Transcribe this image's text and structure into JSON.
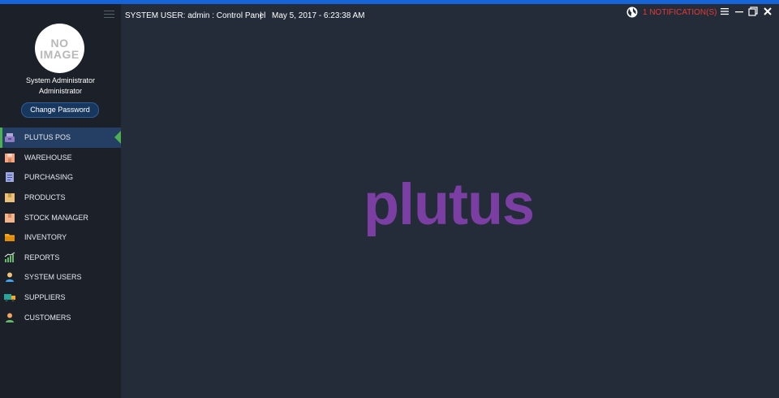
{
  "colors": {
    "top_accent": "#1565d8",
    "sidebar_bg": "#1c2129",
    "main_bg": "#252c39",
    "active_item_bg": "#253e63",
    "active_indicator": "#4caf50",
    "notification_text": "#e53935",
    "logo_color": "#7b3fa3"
  },
  "sidebar": {
    "avatar_line1": "NO",
    "avatar_line2": "IMAGE",
    "user_name": "System Administrator",
    "user_role": "Administrator",
    "change_password_label": "Change Password",
    "items": [
      {
        "label": "PLUTUS POS",
        "icon": "pos-register-icon",
        "active": true
      },
      {
        "label": "WAREHOUSE",
        "icon": "warehouse-icon",
        "active": false
      },
      {
        "label": "PURCHASING",
        "icon": "document-icon",
        "active": false
      },
      {
        "label": "PRODUCTS",
        "icon": "box-icon",
        "active": false
      },
      {
        "label": "STOCK MANAGER",
        "icon": "stock-box-icon",
        "active": false
      },
      {
        "label": "INVENTORY",
        "icon": "folder-icon",
        "active": false
      },
      {
        "label": "REPORTS",
        "icon": "bar-chart-icon",
        "active": false
      },
      {
        "label": "SYSTEM USERS",
        "icon": "user-icon",
        "active": false
      },
      {
        "label": "SUPPLIERS",
        "icon": "truck-icon",
        "active": false
      },
      {
        "label": "CUSTOMERS",
        "icon": "customer-icon",
        "active": false
      }
    ]
  },
  "header": {
    "system_user": "SYSTEM USER: admin : Control Panel",
    "separator": "|",
    "datetime": "May 5, 2017 - 6:23:38 AM",
    "notifications": "1 NOTIFICATION(S)"
  },
  "main": {
    "logo_text": "plutus"
  }
}
